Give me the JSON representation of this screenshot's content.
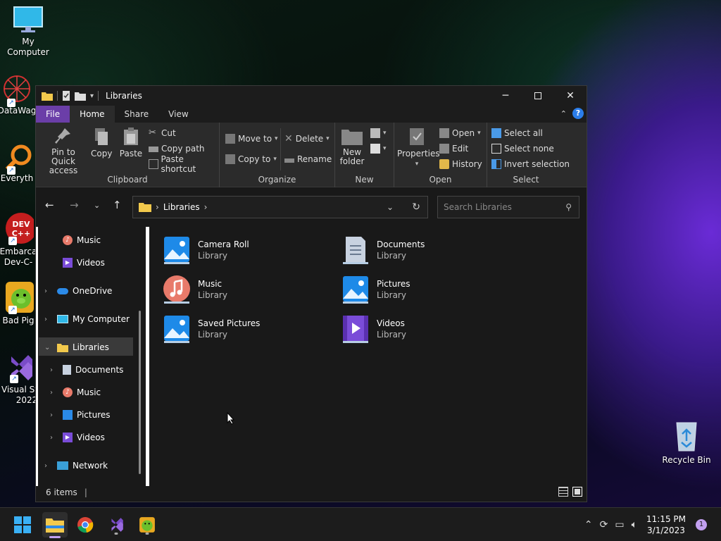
{
  "desktop": {
    "icons": [
      {
        "label": "My Computer",
        "icon": "monitor-icon"
      },
      {
        "label": "DataWag",
        "icon": "datawag-icon"
      },
      {
        "label": "Everyth",
        "icon": "everything-search-icon"
      },
      {
        "label": "Embarca\nDev-C-",
        "label1": "Embarca",
        "label2": "Dev-C-",
        "icon": "devcpp-icon"
      },
      {
        "label": "Bad Pig",
        "icon": "bad-piggies-icon"
      },
      {
        "label1": "Visual St",
        "label2": "2022",
        "icon": "visual-studio-icon"
      },
      {
        "label": "Recycle Bin",
        "icon": "recycle-bin-icon"
      }
    ]
  },
  "window": {
    "title": "Libraries",
    "tabs": {
      "file": "File",
      "home": "Home",
      "share": "Share",
      "view": "View"
    },
    "ribbon": {
      "clipboard": {
        "label": "Clipboard",
        "pin": "Pin to Quick access",
        "pin1": "Pin to Quick",
        "pin2": "access",
        "copy": "Copy",
        "paste": "Paste",
        "cut": "Cut",
        "copy_path": "Copy path",
        "paste_shortcut": "Paste shortcut"
      },
      "organize": {
        "label": "Organize",
        "move_to": "Move to",
        "copy_to": "Copy to",
        "delete": "Delete",
        "rename": "Rename"
      },
      "new": {
        "label": "New",
        "new_folder1": "New",
        "new_folder2": "folder"
      },
      "open": {
        "label": "Open",
        "properties": "Properties",
        "open": "Open",
        "edit": "Edit",
        "history": "History"
      },
      "select": {
        "label": "Select",
        "select_all": "Select all",
        "select_none": "Select none",
        "invert": "Invert selection"
      }
    },
    "address": {
      "path": "Libraries",
      "search_placeholder": "Search Libraries"
    },
    "nav": {
      "items": [
        {
          "label": "Music",
          "icon": "music-icon"
        },
        {
          "label": "Videos",
          "icon": "videos-icon"
        },
        {
          "label": "OneDrive",
          "icon": "onedrive-icon"
        },
        {
          "label": "My Computer",
          "icon": "monitor-icon"
        },
        {
          "label": "Libraries",
          "icon": "folder-icon"
        },
        {
          "label": "Documents",
          "icon": "documents-icon"
        },
        {
          "label": "Music",
          "icon": "music-icon"
        },
        {
          "label": "Pictures",
          "icon": "pictures-icon"
        },
        {
          "label": "Videos",
          "icon": "videos-icon"
        },
        {
          "label": "Network",
          "icon": "network-icon"
        }
      ]
    },
    "content": {
      "items": [
        {
          "name": "Camera Roll",
          "type": "Library",
          "icon": "pictures-icon"
        },
        {
          "name": "Documents",
          "type": "Library",
          "icon": "documents-icon"
        },
        {
          "name": "Music",
          "type": "Library",
          "icon": "music-icon"
        },
        {
          "name": "Pictures",
          "type": "Library",
          "icon": "pictures-icon"
        },
        {
          "name": "Saved Pictures",
          "type": "Library",
          "icon": "pictures-icon"
        },
        {
          "name": "Videos",
          "type": "Library",
          "icon": "videos-icon"
        }
      ]
    },
    "status": {
      "count": "6 items"
    }
  },
  "taskbar": {
    "apps": [
      "start-icon",
      "file-explorer-icon",
      "chrome-icon",
      "visual-studio-icon",
      "bad-piggies-icon"
    ],
    "time": "11:15 PM",
    "date": "3/1/2023",
    "notifications": "1"
  },
  "colors": {
    "accent": "#2b7de9",
    "file_tab": "#6b3ea8",
    "window_bg": "#191919",
    "ribbon_bg": "#2b2b2b"
  }
}
